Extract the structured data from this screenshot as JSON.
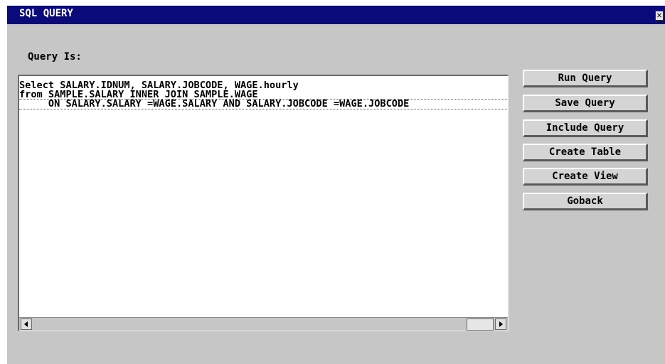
{
  "window": {
    "title": "SQL QUERY",
    "close_glyph": "✕"
  },
  "query": {
    "label": "Query Is:",
    "lines": [
      "Select SALARY.IDNUM, SALARY.JOBCODE, WAGE.hourly",
      "from SAMPLE.SALARY INNER JOIN SAMPLE.WAGE",
      "     ON SALARY.SALARY =WAGE.SALARY AND SALARY.JOBCODE =WAGE.JOBCODE"
    ]
  },
  "buttons": {
    "run": "Run Query",
    "save": "Save Query",
    "include": "Include Query",
    "create_table": "Create Table",
    "create_view": "Create View",
    "goback": "Goback"
  },
  "scrollbar": {
    "position_percent": 100
  }
}
